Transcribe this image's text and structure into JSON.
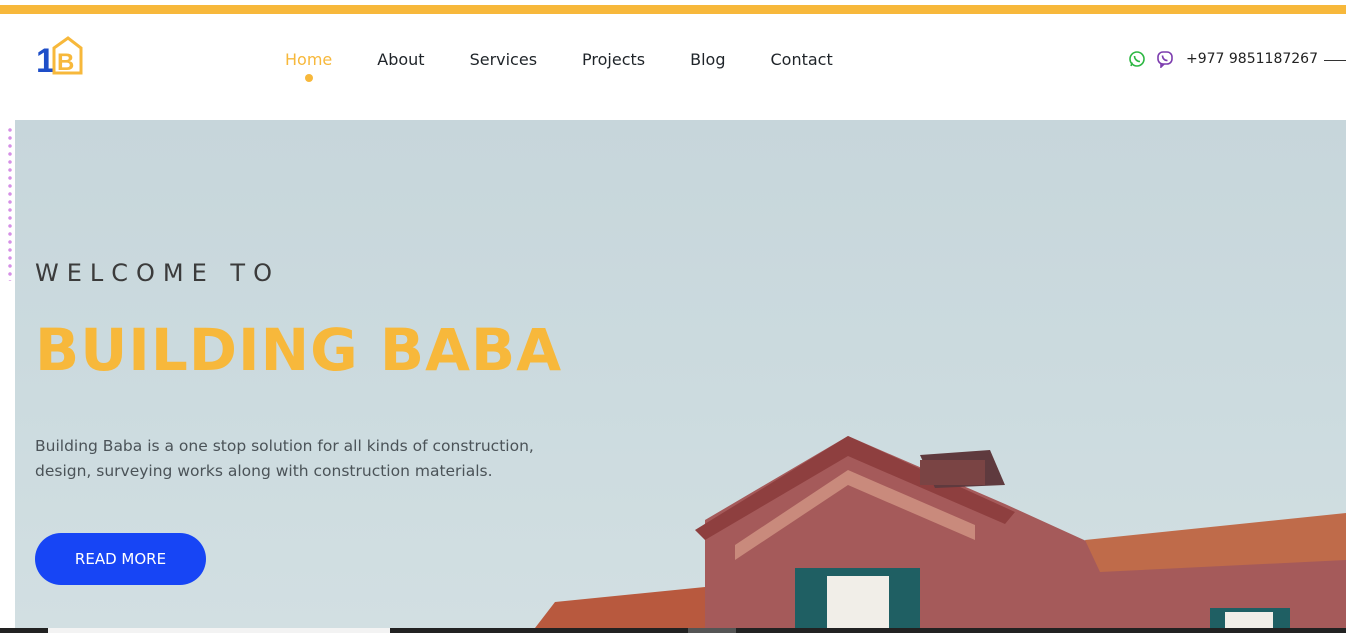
{
  "brand": {
    "logo_alt": "Building Baba logo"
  },
  "nav": {
    "items": [
      {
        "label": "Home",
        "active": true
      },
      {
        "label": "About",
        "active": false
      },
      {
        "label": "Services",
        "active": false
      },
      {
        "label": "Projects",
        "active": false
      },
      {
        "label": "Blog",
        "active": false
      },
      {
        "label": "Contact",
        "active": false
      }
    ]
  },
  "contact": {
    "icons": [
      "whatsapp-icon",
      "viber-icon"
    ],
    "phone": "+977 9851187267"
  },
  "hero": {
    "welcome": "WELCOME TO",
    "title": "BUILDING BABA",
    "description": "Building Baba is a one stop solution for all kinds of construction, design, surveying works along with construction materials.",
    "cta": "READ MORE"
  },
  "colors": {
    "accent": "#f7b83b",
    "button": "#1745f5",
    "text": "#1f2429"
  }
}
